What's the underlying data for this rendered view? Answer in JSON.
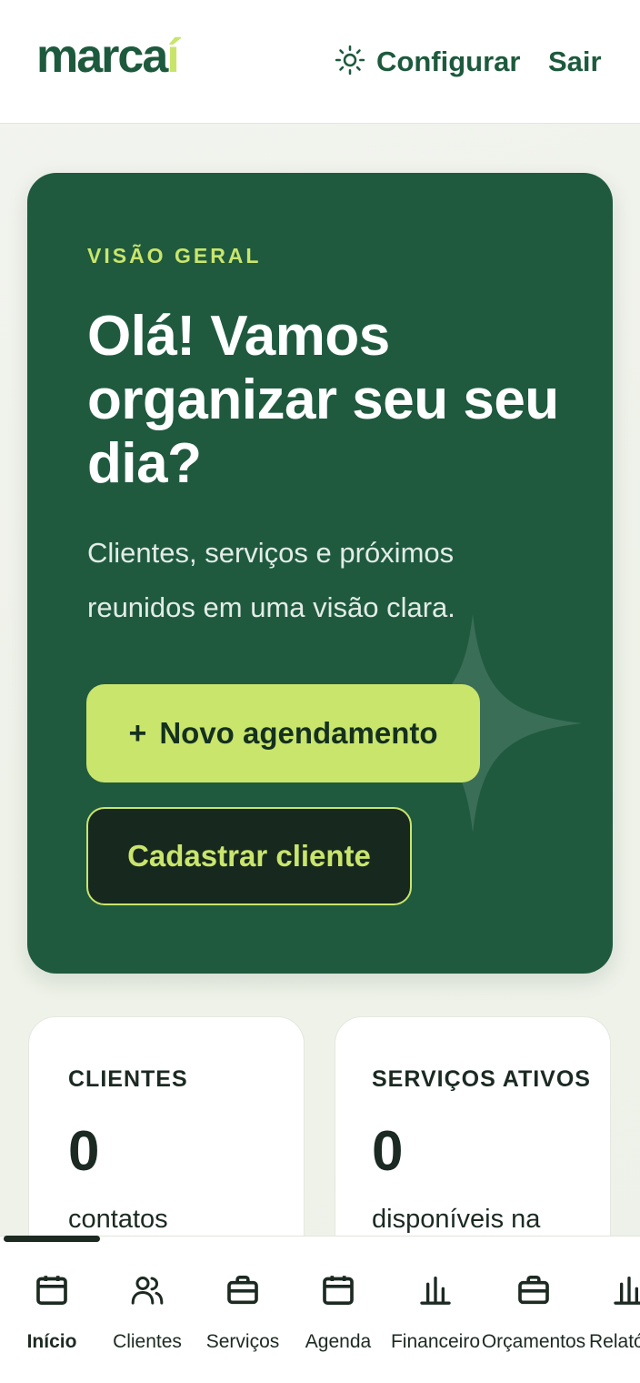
{
  "header": {
    "logo_main": "marca",
    "logo_accent": "í",
    "config_label": "Configurar",
    "logout_label": "Sair"
  },
  "hero": {
    "eyebrow": "VISÃO GERAL",
    "title": "Olá! Vamos organizar seu seu dia?",
    "subtitle": "Clientes, serviços e próximos reunidos em uma visão clara.",
    "primary_icon": "+",
    "primary_label": "Novo agendamento",
    "secondary_label": "Cadastrar cliente"
  },
  "stats": [
    {
      "title": "CLIENTES",
      "value": "0",
      "desc": "contatos"
    },
    {
      "title": "SERVIÇOS ATIVOS",
      "value": "0",
      "desc": "disponíveis na"
    }
  ],
  "nav": {
    "items": [
      {
        "label": "Início",
        "icon": "calendar-icon",
        "active": true
      },
      {
        "label": "Clientes",
        "icon": "users-icon",
        "active": false
      },
      {
        "label": "Serviços",
        "icon": "briefcase-icon",
        "active": false
      },
      {
        "label": "Agenda",
        "icon": "calendar-icon",
        "active": false
      },
      {
        "label": "Financeiro",
        "icon": "bar-chart-icon",
        "active": false
      },
      {
        "label": "Orçamentos",
        "icon": "briefcase-icon",
        "active": false
      },
      {
        "label": "Relató",
        "icon": "bar-chart-icon",
        "active": false
      }
    ]
  },
  "colors": {
    "brand_dark": "#1f5a3f",
    "brand_accent": "#c9e56c",
    "text_dark": "#1b2a22"
  }
}
